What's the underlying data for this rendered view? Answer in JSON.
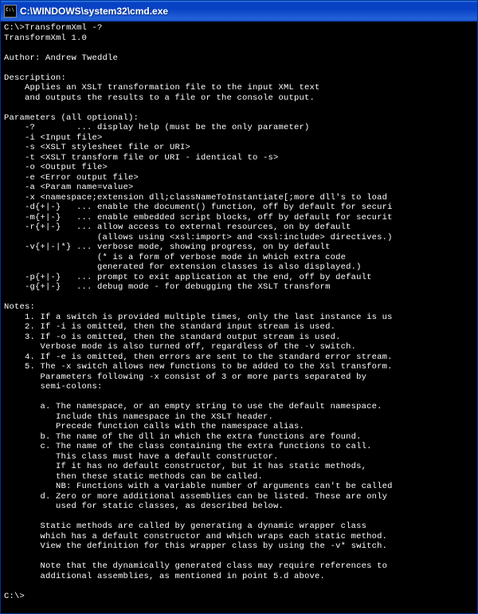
{
  "titlebar": {
    "title": "C:\\WINDOWS\\system32\\cmd.exe"
  },
  "console": {
    "prompt1": "C:\\>TransformXml -?",
    "header": "TransformXml 1.0",
    "blank": "",
    "author": "Author: Andrew Tweddle",
    "descLabel": "Description:",
    "desc1": "    Applies an XSLT transformation file to the input XML text",
    "desc2": "    and outputs the results to a file or the console output.",
    "paramsLabel": "Parameters (all optional):",
    "p1": "    -?        ... display help (must be the only parameter)",
    "p2": "    -i <Input file>",
    "p3": "    -s <XSLT stylesheet file or URI>",
    "p4": "    -t <XSLT transform file or URI - identical to -s>",
    "p5": "    -o <Output file>",
    "p6": "    -e <Error output file>",
    "p7": "    -a <Param name=value>",
    "p8": "    -x <namespace;extension dll;classNameToInstantiate[;more dll's to load",
    "p9": "    -d{+|-}   ... enable the document() function, off by default for securi",
    "p10": "    -m{+|-}   ... enable embedded script blocks, off by default for securit",
    "p11": "    -r{+|-}   ... allow access to external resources, on by default",
    "p12": "                  (allows using <xsl:import> and <xsl:include> directives.)",
    "p13": "    -v{+|-|*} ... verbose mode, showing progress, on by default",
    "p14": "                  (* is a form of verbose mode in which extra code",
    "p15": "                  generated for extension classes is also displayed.)",
    "p16": "    -p{+|-}   ... prompt to exit application at the end, off by default",
    "p17": "    -g{+|-}   ... debug mode - for debugging the XSLT transform",
    "notesLabel": "Notes:",
    "n1": "    1. If a switch is provided multiple times, only the last instance is us",
    "n2": "    2. If -i is omitted, then the standard input stream is used.",
    "n3": "    3. If -o is omitted, then the standard output stream is used.",
    "n4": "       Verbose mode is also turned off, regardless of the -v switch.",
    "n5": "    4. If -e is omitted, then errors are sent to the standard error stream.",
    "n6": "    5. The -x switch allows new functions to be added to the Xsl transform.",
    "n7": "       Parameters following -x consist of 3 or more parts separated by",
    "n8": "       semi-colons:",
    "n9": "       a. The namespace, or an empty string to use the default namespace.",
    "n10": "          Include this namespace in the XSLT header.",
    "n11": "          Precede function calls with the namespace alias.",
    "n12": "       b. The name of the dll in which the extra functions are found.",
    "n13": "       c. The name of the class containing the extra functions to call.",
    "n14": "          This class must have a default constructor.",
    "n15": "          If it has no default constructor, but it has static methods,",
    "n16": "          then these static methods can be called.",
    "n17": "          NB: Functions with a variable number of arguments can't be called",
    "n18": "       d. Zero or more additional assemblies can be listed. These are only",
    "n19": "          used for static classes, as described below.",
    "n20": "       Static methods are called by generating a dynamic wrapper class",
    "n21": "       which has a default constructor and which wraps each static method.",
    "n22": "       View the definition for this wrapper class by using the -v* switch.",
    "n23": "       Note that the dynamically generated class may require references to",
    "n24": "       additional assemblies, as mentioned in point 5.d above.",
    "prompt2": "C:\\>"
  }
}
